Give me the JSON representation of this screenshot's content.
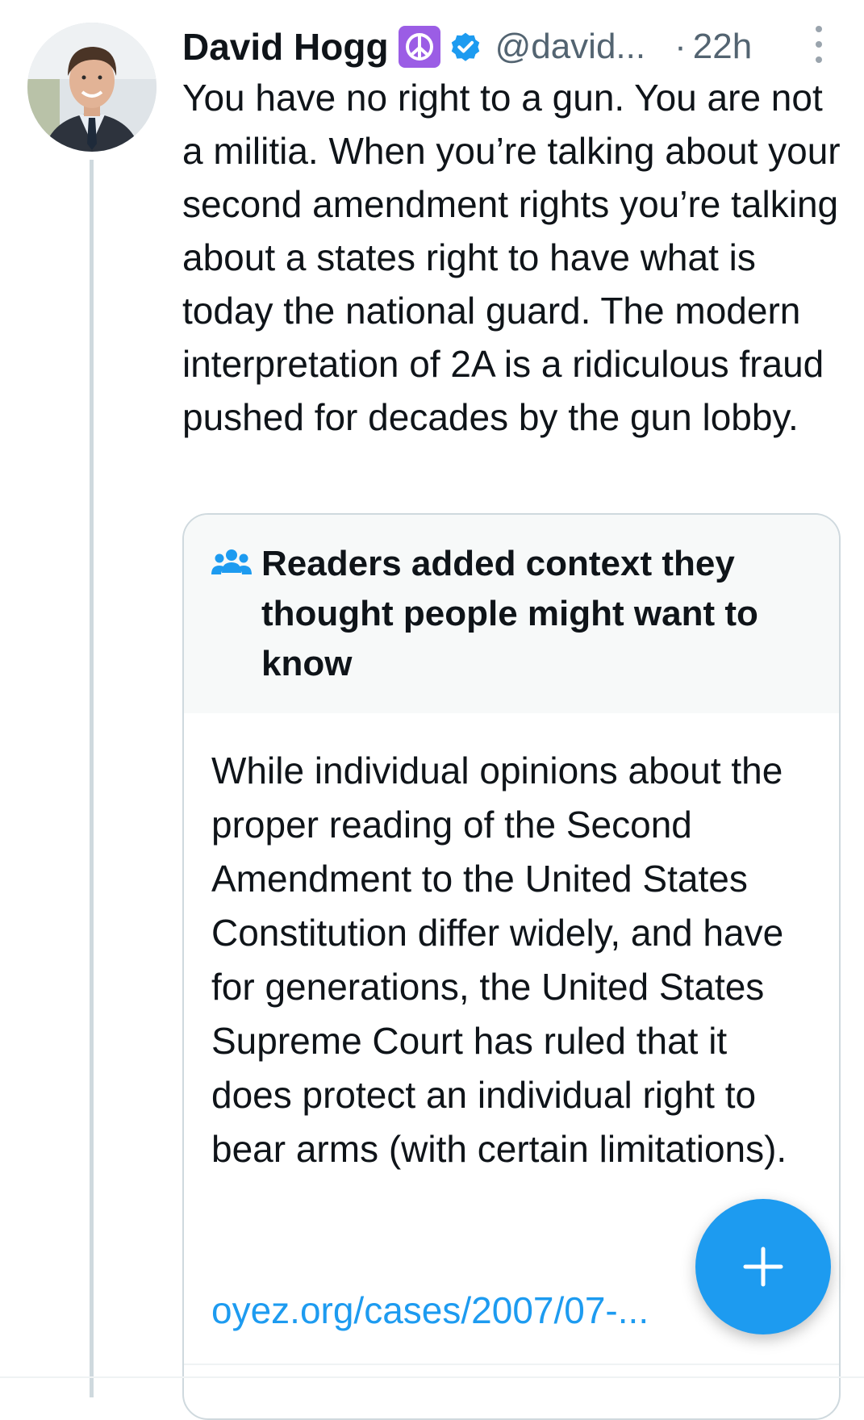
{
  "tweet": {
    "author_name": "David Hogg",
    "handle": "@david...",
    "separator": "·",
    "time": "22h",
    "text": "You have no right to a gun. You are not a militia. When you’re talking about your second amendment rights you’re talking about a states right to have what is today the national guard. The modern interpretation of 2A is a ridiculous fraud pushed for decades by the gun lobby.",
    "badges": {
      "emoji_badge_icon": "peace-symbol-icon",
      "emoji_badge_color": "#9b5de5",
      "verified_icon": "verified-check-icon",
      "verified_color": "#1d9bf0"
    }
  },
  "community_note": {
    "icon": "people-group-icon",
    "title": "Readers added context they thought people might want to know",
    "body": "While individual opinions about the proper reading of the Second Amendment to the United States Constitution differ widely, and have for generations, the United States Supreme Court has ruled that it does protect an individual right to bear arms (with certain limitations).",
    "link_text": "oyez.org/cases/2007/07-..."
  },
  "fab": {
    "icon": "plus-icon",
    "color": "#1d9bf0"
  },
  "colors": {
    "text_primary": "#0f1419",
    "text_secondary": "#536471",
    "accent": "#1d9bf0",
    "border": "#cfd9de"
  }
}
